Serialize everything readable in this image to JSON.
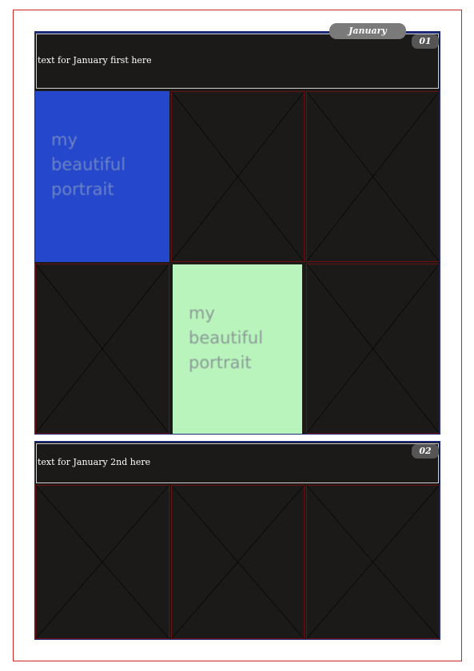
{
  "month": {
    "label": "January"
  },
  "days": [
    {
      "number": "01",
      "text": "text for January first here",
      "cells": [
        {
          "kind": "portrait",
          "label": [
            "my",
            "beautiful",
            "portrait"
          ],
          "color": "#2447cc"
        },
        {
          "kind": "placeholder"
        },
        {
          "kind": "placeholder"
        },
        {
          "kind": "placeholder"
        },
        {
          "kind": "portrait",
          "label": [
            "my",
            "beautiful",
            "portrait"
          ],
          "color": "#b8f4bc"
        },
        {
          "kind": "placeholder"
        }
      ]
    },
    {
      "number": "02",
      "text": "text for January 2nd here",
      "cells": [
        {
          "kind": "placeholder"
        },
        {
          "kind": "placeholder"
        },
        {
          "kind": "placeholder"
        }
      ]
    }
  ],
  "colors": {
    "background": "#ffffff",
    "page_border": "#cc2222",
    "cell_background": "#1b1a19",
    "month_tab": "#7a7a7a",
    "day_badge": "#555555"
  }
}
